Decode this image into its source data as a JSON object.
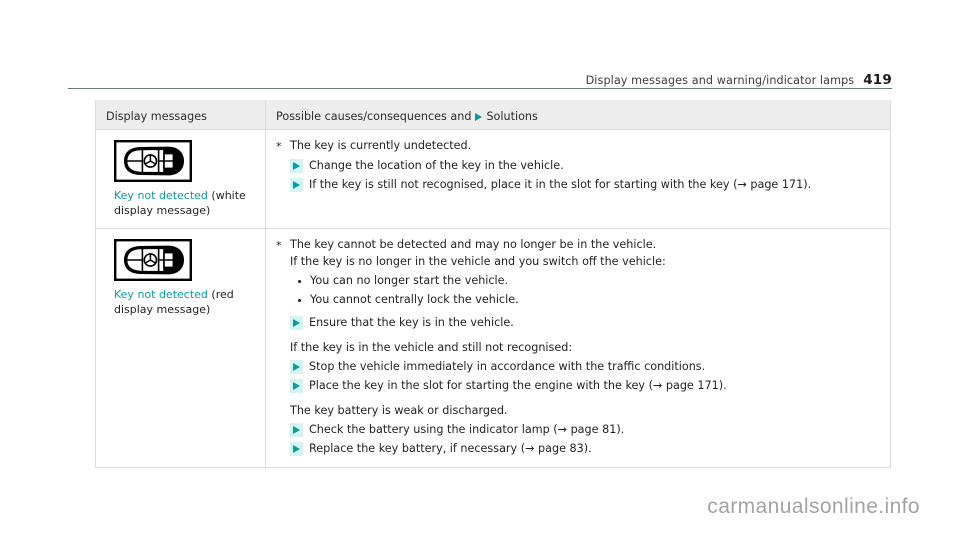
{
  "running_header": {
    "title": "Display messages and warning/indicator lamps",
    "page_number": "419"
  },
  "table": {
    "columns": {
      "left": "Display messages",
      "right_prefix": "Possible causes/consequences and",
      "right_suffix": "Solutions",
      "right_marker_icon": "solution-triangle-icon"
    },
    "rows": [
      {
        "icon": "key-fob-icon",
        "message_name": "Key not detected",
        "message_qualifier": " (white display message)",
        "blocks": [
          {
            "type": "cause",
            "marker": "*",
            "text": "The key is currently undetected."
          },
          {
            "type": "solution",
            "text": "Change the location of the key in the vehicle."
          },
          {
            "type": "solution",
            "text": "If the key is still not recognised, place it in the slot for starting with the key (→ page 171)."
          }
        ]
      },
      {
        "icon": "key-fob-icon",
        "message_name": "Key not detected",
        "message_qualifier": " (red display message)",
        "blocks": [
          {
            "type": "cause",
            "marker": "*",
            "text": "The key cannot be detected and may no longer be in the vehicle."
          },
          {
            "type": "plain",
            "text": "If the key is no longer in the vehicle and you switch off the vehicle:"
          },
          {
            "type": "bullet",
            "text": "You can no longer start the vehicle."
          },
          {
            "type": "bullet",
            "text": "You cannot centrally lock the vehicle."
          },
          {
            "type": "solution",
            "text": "Ensure that the key is in the vehicle."
          },
          {
            "type": "spacer"
          },
          {
            "type": "plain",
            "text": "If the key is in the vehicle and still not recognised:"
          },
          {
            "type": "solution",
            "text": "Stop the vehicle immediately in accordance with the traffic conditions."
          },
          {
            "type": "solution",
            "text": "Place the key in the slot for starting the engine with the key (→ page 171)."
          },
          {
            "type": "spacer"
          },
          {
            "type": "plain",
            "text": "The key battery is weak or discharged."
          },
          {
            "type": "solution",
            "text": "Check the battery using the indicator lamp (→ page 81)."
          },
          {
            "type": "solution",
            "text": "Replace the key battery, if necessary (→ page 83)."
          }
        ]
      }
    ]
  },
  "watermark": "carmanualsonline.info",
  "colors": {
    "accent_teal": "#0c9b9b",
    "marker_bg": "#d4f4f4",
    "header_row_bg": "#ededed",
    "border": "#dcdcdc",
    "text": "#231f20",
    "watermark": "#a3a3a3"
  }
}
